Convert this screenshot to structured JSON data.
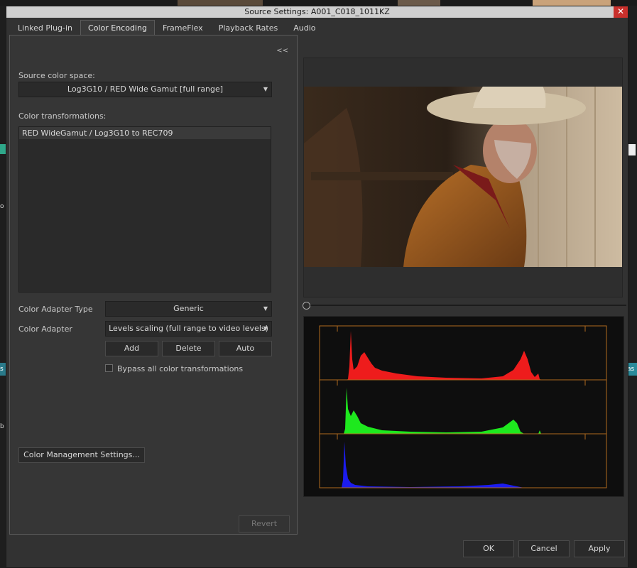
{
  "window": {
    "title": "Source Settings: A001_C018_1011KZ",
    "close_glyph": "✕"
  },
  "tabs": [
    {
      "label": "Linked Plug-in"
    },
    {
      "label": "Color Encoding"
    },
    {
      "label": "FrameFlex"
    },
    {
      "label": "Playback Rates"
    },
    {
      "label": "Audio"
    }
  ],
  "active_tab": "Color Encoding",
  "panel": {
    "collapse_label": "<<",
    "source_color_space_label": "Source color space:",
    "source_color_space_value": "Log3G10 / RED Wide Gamut  [full range]",
    "color_transformations_label": "Color transformations:",
    "transformations": [
      "RED WideGamut / Log3G10 to REC709"
    ],
    "adapter_type_label": "Color Adapter Type",
    "adapter_type_value": "Generic",
    "adapter_label": "Color Adapter",
    "adapter_value": "Levels scaling (full range to video levels)",
    "add_label": "Add",
    "delete_label": "Delete",
    "auto_label": "Auto",
    "bypass_label": "Bypass all color transformations",
    "bypass_checked": false,
    "color_management_label": "Color Management Settings...",
    "revert_label": "Revert"
  },
  "footer": {
    "ok_label": "OK",
    "cancel_label": "Cancel",
    "apply_label": "Apply"
  },
  "background": {
    "left_chip_1": "o",
    "left_chip_2": "s",
    "left_chip_3": "b",
    "right_chip_1": "as"
  },
  "colors": {
    "dialog_bg": "#323232",
    "titlebar_bg": "#cfcfcf",
    "close_bg": "#c9302c",
    "histogram_frame": "#b06a1e",
    "histogram_red": "#ee1c1c",
    "histogram_green": "#1ee81e",
    "histogram_blue": "#1c1cee"
  },
  "icons": {
    "close": "close-icon",
    "dropdown": "chevron-down-icon"
  }
}
